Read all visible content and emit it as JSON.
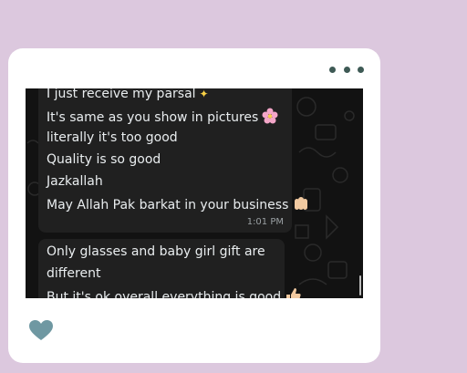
{
  "post": {
    "menu_icon": "more-horizontal-icon",
    "like_icon": "heart-icon",
    "like_color": "#6f98a2"
  },
  "chat": {
    "messages": [
      {
        "lines": [
          "I just receive my parsal",
          "It's same as you show in pictures",
          "literally it's too good",
          "Quality is so good",
          "Jazkallah",
          "May Allah Pak barkat in your business"
        ],
        "time": "1:01 PM"
      },
      {
        "lines": [
          "Only glasses and baby girl gift are",
          "different",
          "But it's ok overall everything is good"
        ]
      }
    ],
    "bubble_color": "#202020",
    "background_color": "#121212"
  }
}
